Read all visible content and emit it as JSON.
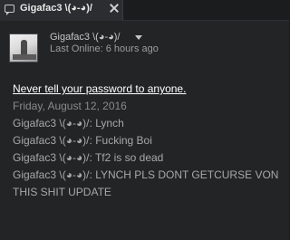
{
  "tab": {
    "label": "Gigafac3  \\(◕-◕)/",
    "chat_icon": "chat-bubble-icon",
    "close_icon": "close-icon"
  },
  "header": {
    "persona_name": "Gigafac3  \\(◕-◕)/",
    "status": "Last Online: 6 hours ago"
  },
  "chat": {
    "security_warning": "Never tell your password to anyone.",
    "date": "Friday, August 12, 2016",
    "messages": [
      {
        "sender": "Gigafac3  \\(◕-◕)/",
        "text": "Lynch"
      },
      {
        "sender": "Gigafac3  \\(◕-◕)/",
        "text": "Fucking Boi"
      },
      {
        "sender": "Gigafac3  \\(◕-◕)/",
        "text": "Tf2 is so dead"
      },
      {
        "sender": "Gigafac3  \\(◕-◕)/",
        "text": "LYNCH PLS DONT GETCURSE VON THIS SHIT UPDATE"
      }
    ]
  }
}
